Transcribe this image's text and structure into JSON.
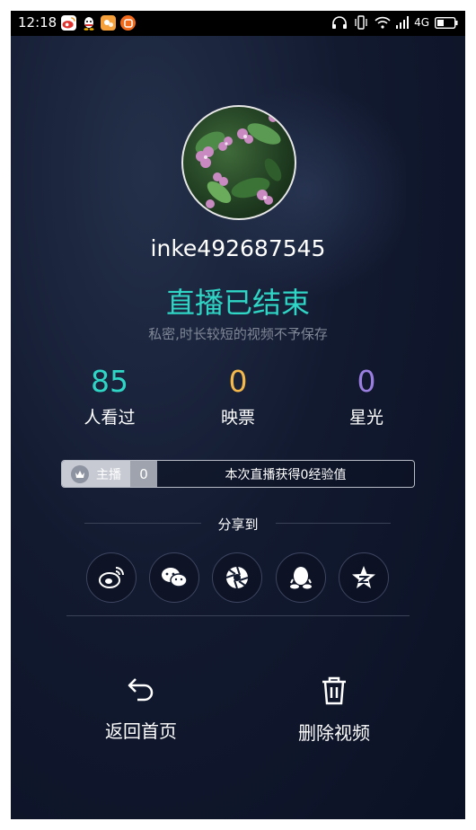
{
  "status_bar": {
    "time": "12:18",
    "network": "4G",
    "icons_left": [
      "weibo-icon",
      "qq-icon",
      "app-icon",
      "notification-icon"
    ],
    "icons_right": [
      "headphone-icon",
      "vibrate-icon",
      "wifi-icon",
      "signal-icon",
      "battery-icon"
    ]
  },
  "profile": {
    "username": "inke492687545",
    "status_title": "直播已结束",
    "note": "私密,时长较短的视频不予保存"
  },
  "stats": [
    {
      "value": "85",
      "label": "人看过",
      "color": "#2fd5c5"
    },
    {
      "value": "0",
      "label": "映票",
      "color": "#f5b84a"
    },
    {
      "value": "0",
      "label": "星光",
      "color": "#9b7fe0"
    }
  ],
  "exp_bar": {
    "host_label": "主播",
    "level": "0",
    "message": "本次直播获得0经验值"
  },
  "share": {
    "title": "分享到",
    "targets": [
      "weibo",
      "wechat",
      "moments",
      "qq",
      "qzone"
    ]
  },
  "actions": {
    "back_label": "返回首页",
    "delete_label": "删除视频"
  },
  "colors": {
    "accent": "#2fd5c5",
    "background": "#121a30"
  }
}
